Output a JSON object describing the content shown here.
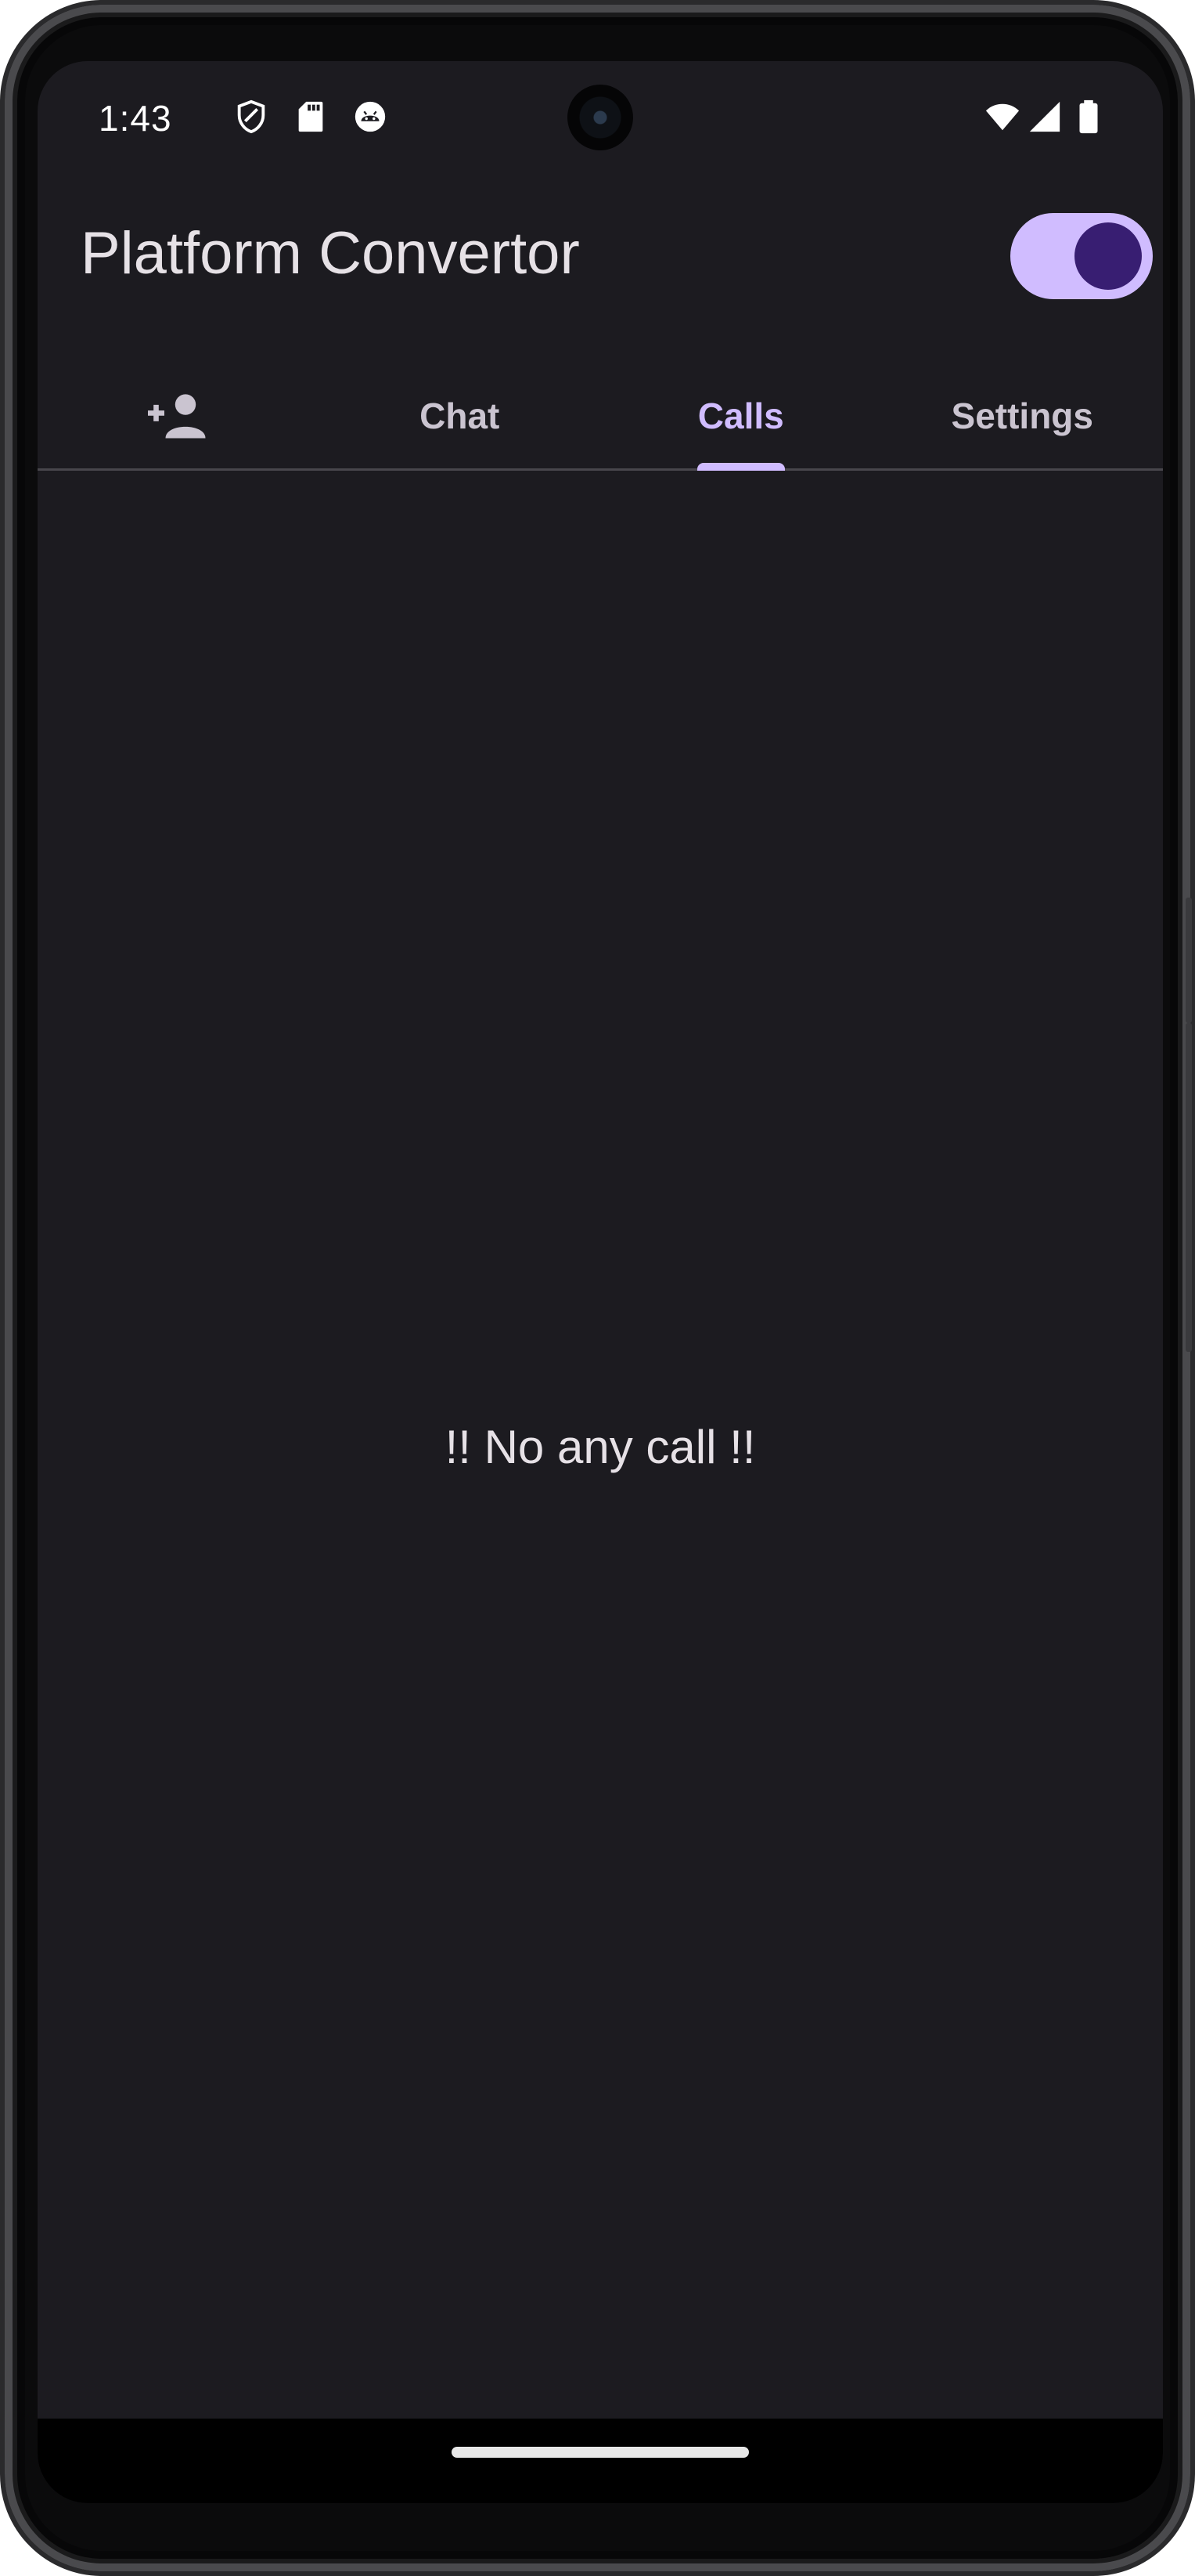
{
  "status_bar": {
    "time": "1:43",
    "left_icons": [
      "shield-icon",
      "sd-card-icon",
      "android-debug-icon"
    ],
    "right_icons": [
      "wifi-icon",
      "cell-signal-icon",
      "battery-icon"
    ]
  },
  "app_bar": {
    "title": "Platform Convertor",
    "theme_switch_on": true
  },
  "tabs": [
    {
      "label": "",
      "icon": "person-add-icon",
      "active": false
    },
    {
      "label": "Chat",
      "active": false
    },
    {
      "label": "Calls",
      "active": true
    },
    {
      "label": "Settings",
      "active": false
    }
  ],
  "main": {
    "empty_message": "!! No any call !!"
  },
  "colors": {
    "background": "#1c1b20",
    "accent": "#d0bcff",
    "switch_thumb": "#381e72",
    "tab_text": "#cac4d0"
  }
}
